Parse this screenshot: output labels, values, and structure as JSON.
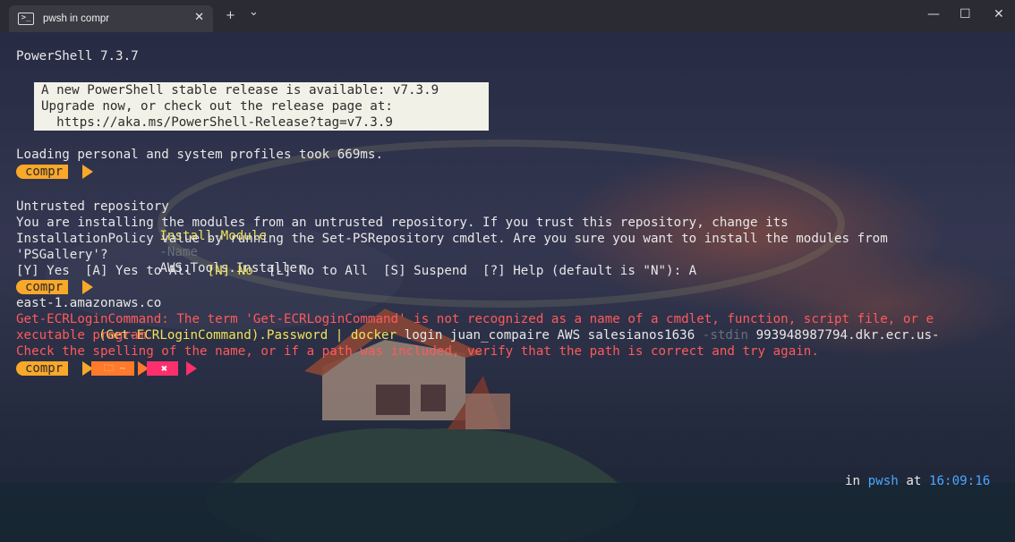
{
  "window": {
    "tab_title": "pwsh in compr",
    "tab_icon": "powershell-icon",
    "close_tab_glyph": "✕",
    "new_tab_glyph": "+",
    "dropdown_glyph": "⌄",
    "minimize_glyph": "—",
    "maximize_glyph": "☐",
    "close_glyph": "✕"
  },
  "terminal": {
    "version_line": "PowerShell 7.3.7",
    "notice": [
      "A new PowerShell stable release is available: v7.3.9",
      "Upgrade now, or check out the release page at:",
      "  https://aka.ms/PowerShell-Release?tag=v7.3.9"
    ],
    "profile_line": "Loading personal and system profiles took 669ms.",
    "prompt_label": "compr",
    "cmd1": {
      "cmdlet": "Install-Module",
      "param": "-Name",
      "value": "AWS.Tools.Installer"
    },
    "untrusted_header": "Untrusted repository",
    "untrusted_lines": [
      "You are installing the modules from an untrusted repository. If you trust this repository, change its",
      "InstallationPolicy value by running the Set-PSRepository cmdlet. Are you sure you want to install the modules from",
      "'PSGallery'?"
    ],
    "choice": {
      "yes": "[Y] Yes  ",
      "yes_all": "[A] Yes to All  ",
      "no": "[N] No",
      "rest": "  [L] No to All  [S] Suspend  [?] Help (default is \"N\"): A"
    },
    "cmd2": {
      "part1": "(Get-ECRLoginCommand).Password | ",
      "part2": "docker",
      "part3": " login juan_compaire AWS salesianos1636 ",
      "param": "-stdin",
      "part4": " 993948987794.dkr.ecr.us-",
      "wrap": "east-1.amazonaws.co"
    },
    "errors": [
      "Get-ECRLoginCommand: The term 'Get-ECRLoginCommand' is not recognized as a name of a cmdlet, function, script file, or e",
      "xecutable program.",
      "Check the spelling of the name, or if a path was included, verify that the path is correct and try again."
    ],
    "last_prompt": {
      "folder_glyph": "🗀 ~",
      "x_glyph": "✖",
      "right_in": "in ",
      "right_shell": "pwsh",
      "right_at": " at ",
      "right_time": "16:09:16"
    }
  },
  "colors": {
    "prompt_orange": "#f9a82a",
    "path_orange": "#ff7a2a",
    "error_pink": "#ff2f6e",
    "error_text": "#ff5a5a",
    "cmdlet_yellow": "#f0e35a",
    "time_blue": "#49a7ff"
  }
}
